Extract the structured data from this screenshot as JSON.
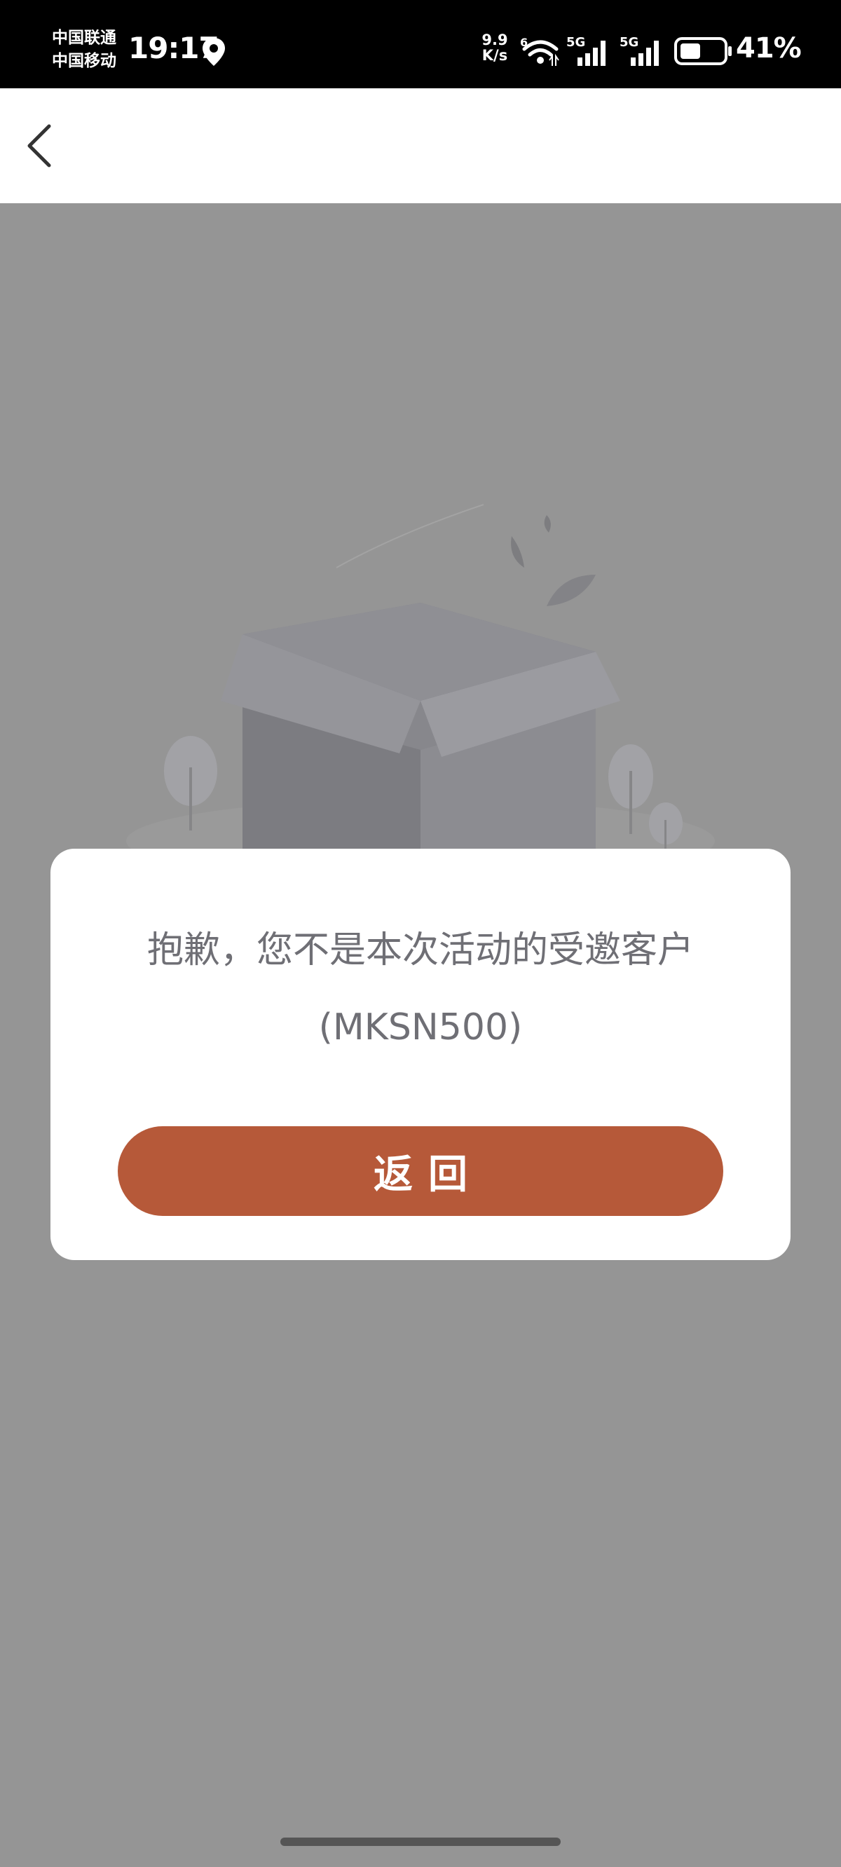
{
  "status_bar": {
    "carrier_1": "中国联通",
    "carrier_2": "中国移动",
    "time": "19:17",
    "net_speed_value": "9.9",
    "net_speed_unit": "K/s",
    "battery": "41%"
  },
  "dialog": {
    "message_line_1": "抱歉，您不是本次活动的受邀客户",
    "message_line_2": "(MKSN500)",
    "return_label": "返回"
  },
  "colors": {
    "overlay": "#959595",
    "accent": "#b65939"
  }
}
